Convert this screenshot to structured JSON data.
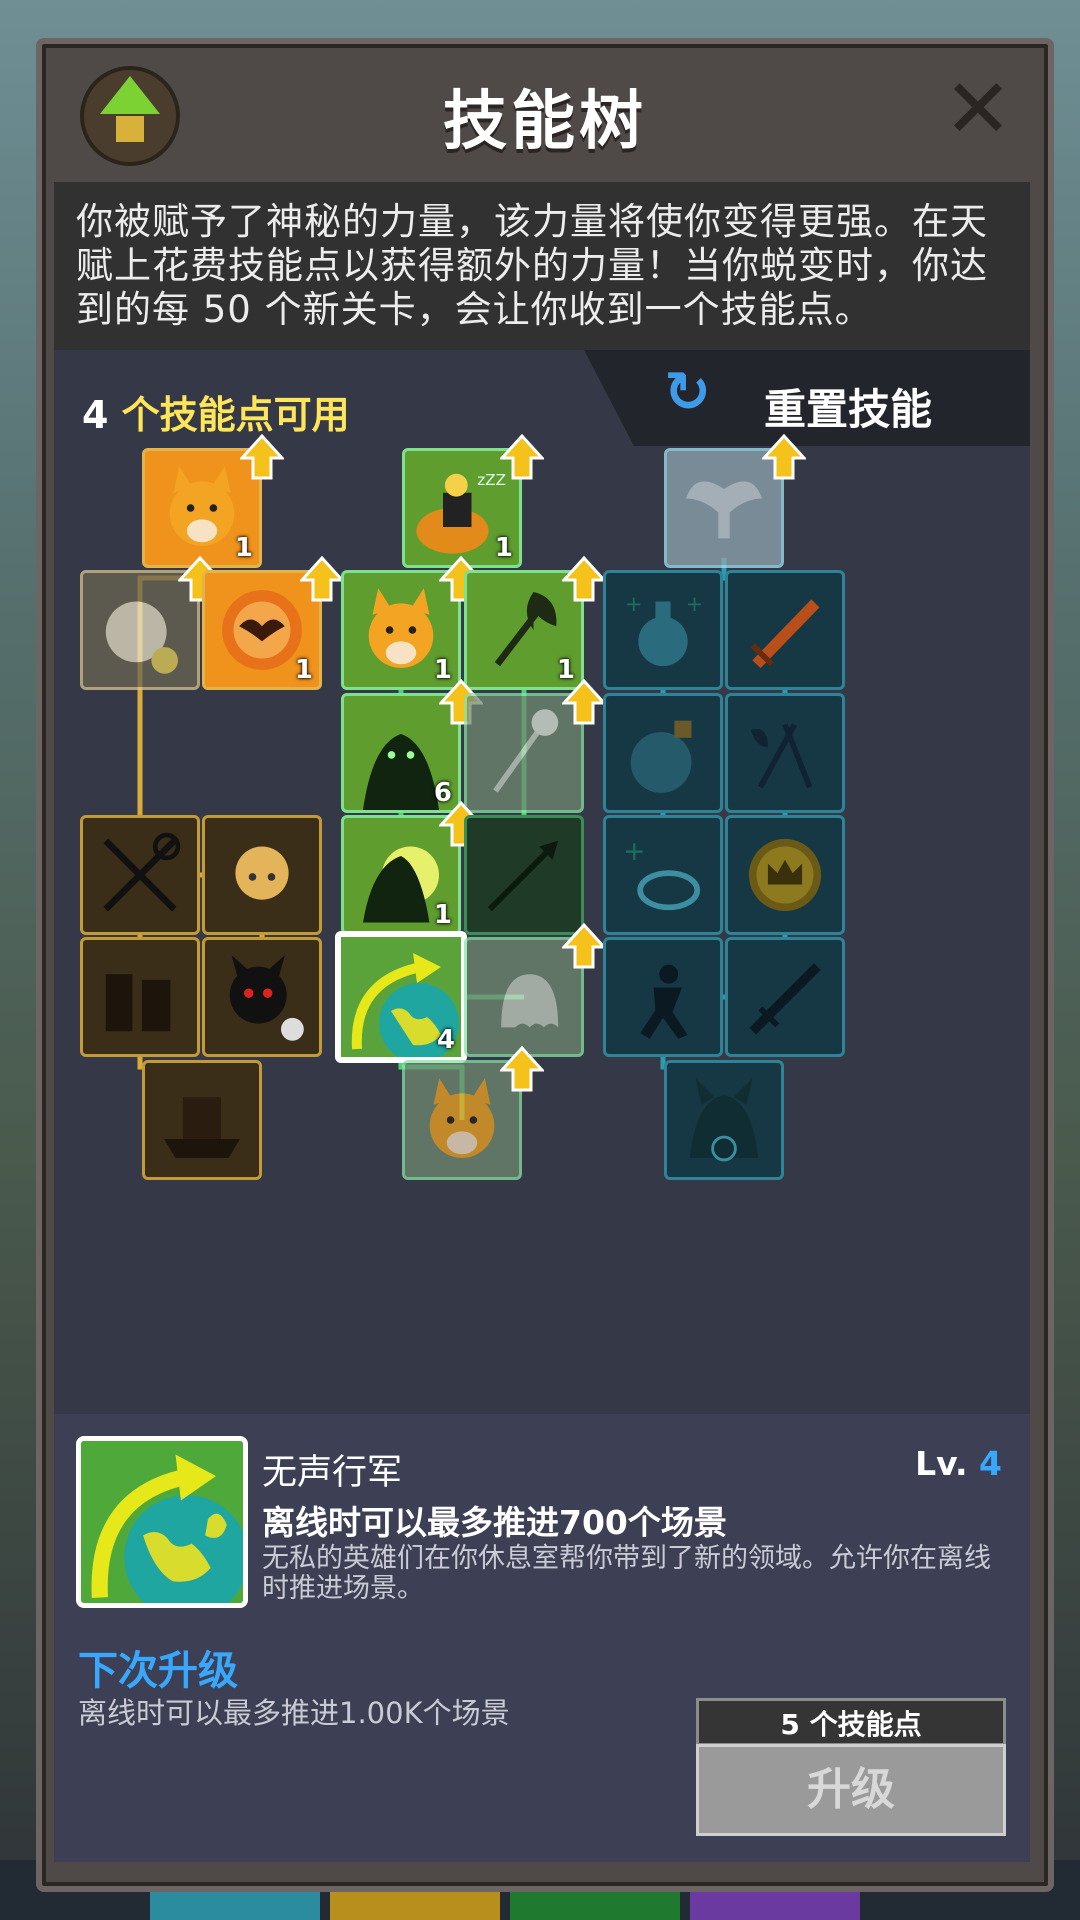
{
  "header": {
    "title": "技能树"
  },
  "description": "你被赋予了神秘的力量，该力量将使你变得更强。在天赋上花费技能点以获得额外的力量！当你蜕变时，你达到的每 50 个新关卡，会让你收到一个技能点。",
  "points": {
    "count": "4",
    "label": " 个技能点可用"
  },
  "reset": {
    "label": "重置技能"
  },
  "tree": {
    "colors": {
      "gold": "#d9ab3a",
      "green": "#4fd178",
      "cyan": "#2b9bb1"
    },
    "nodes": [
      {
        "id": "g1",
        "state": "active",
        "level": "1",
        "upgradable": true,
        "icon": "cat-icon"
      },
      {
        "id": "g2",
        "state": "dim",
        "level": "",
        "upgradable": true,
        "icon": "cat-coin-icon"
      },
      {
        "id": "g3",
        "state": "active",
        "level": "1",
        "upgradable": true,
        "icon": "bat-orb-icon"
      },
      {
        "id": "g4",
        "state": "locked",
        "level": "",
        "upgradable": false,
        "icon": "crossed-weapons-icon"
      },
      {
        "id": "g5",
        "state": "locked",
        "level": "",
        "upgradable": false,
        "icon": "fairy-icon"
      },
      {
        "id": "g6",
        "state": "locked",
        "level": "",
        "upgradable": false,
        "icon": "heroes-icon"
      },
      {
        "id": "g7",
        "state": "locked",
        "level": "",
        "upgradable": false,
        "icon": "demon-clock-icon"
      },
      {
        "id": "g8",
        "state": "locked",
        "level": "",
        "upgradable": false,
        "icon": "ship-icon"
      },
      {
        "id": "m1",
        "state": "active",
        "level": "1",
        "upgradable": true,
        "icon": "sleeping-hero-icon"
      },
      {
        "id": "m2",
        "state": "active",
        "level": "1",
        "upgradable": true,
        "icon": "cat-icon"
      },
      {
        "id": "m3",
        "state": "active",
        "level": "1",
        "upgradable": true,
        "icon": "axe-icon"
      },
      {
        "id": "m4",
        "state": "active",
        "level": "6",
        "upgradable": true,
        "icon": "shadow-monster-icon"
      },
      {
        "id": "m5",
        "state": "dim",
        "level": "",
        "upgradable": true,
        "icon": "staff-icon"
      },
      {
        "id": "m6",
        "state": "active",
        "level": "1",
        "upgradable": true,
        "icon": "shadow-burst-icon"
      },
      {
        "id": "m7",
        "state": "locked",
        "level": "",
        "upgradable": false,
        "icon": "arrow-icon"
      },
      {
        "id": "m8",
        "state": "selected",
        "level": "4",
        "upgradable": false,
        "icon": "globe-arrow-icon"
      },
      {
        "id": "m9",
        "state": "dim",
        "level": "",
        "upgradable": true,
        "icon": "ghost-icon"
      },
      {
        "id": "m10",
        "state": "dim",
        "level": "",
        "upgradable": true,
        "icon": "cat-icon"
      },
      {
        "id": "c1",
        "state": "dim",
        "level": "",
        "upgradable": true,
        "icon": "winged-figure-icon"
      },
      {
        "id": "c2",
        "state": "locked",
        "level": "",
        "upgradable": false,
        "icon": "potion-icon"
      },
      {
        "id": "c3",
        "state": "locked",
        "level": "",
        "upgradable": false,
        "icon": "fire-sword-icon"
      },
      {
        "id": "c4",
        "state": "locked",
        "level": "",
        "upgradable": false,
        "icon": "bomb-icon"
      },
      {
        "id": "c5",
        "state": "locked",
        "level": "",
        "upgradable": false,
        "icon": "weapons-icon"
      },
      {
        "id": "c6",
        "state": "locked",
        "level": "",
        "upgradable": false,
        "icon": "heal-ring-icon"
      },
      {
        "id": "c7",
        "state": "locked",
        "level": "",
        "upgradable": false,
        "icon": "crown-coin-icon"
      },
      {
        "id": "c8",
        "state": "locked",
        "level": "",
        "upgradable": false,
        "icon": "runner-icon"
      },
      {
        "id": "c9",
        "state": "locked",
        "level": "",
        "upgradable": false,
        "icon": "lightning-sword-icon"
      },
      {
        "id": "c10",
        "state": "locked",
        "level": "",
        "upgradable": false,
        "icon": "werewolf-icon"
      }
    ]
  },
  "detail": {
    "name": "无声行军",
    "lv_prefix": "Lv. ",
    "lv_value": "4",
    "effect": "离线时可以最多推进700个场景",
    "text": "无私的英雄们在你休息室帮你带到了新的领域。允许你在离线时推进场景。",
    "next_title": "下次升级",
    "next_text": "离线时可以最多推进1.00K个场景",
    "cost": "5 个技能点",
    "upgrade_label": "升级"
  }
}
